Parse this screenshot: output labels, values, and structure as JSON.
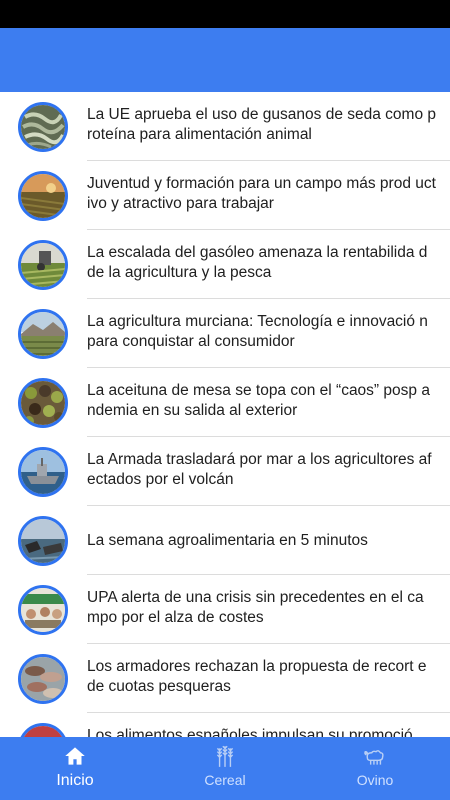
{
  "colors": {
    "primary": "#3d7df0",
    "thumb_border": "#2f73f0",
    "status_bar": "#000000"
  },
  "news": [
    {
      "title": "La UE aprueba el uso de gusanos de seda como proteína para alimentación animal",
      "thumb": "silkworms"
    },
    {
      "title": "Juventud y formación para un campo más prod uctivo y atractivo para trabajar",
      "thumb": "field-sunset"
    },
    {
      "title": "La escalada del gasóleo amenaza la rentabilida d de la agricultura y la pesca",
      "thumb": "tractor-field"
    },
    {
      "title": "La agricultura murciana: Tecnología e innovació n para conquistar al consumidor",
      "thumb": "mountain-field"
    },
    {
      "title": "La aceituna de mesa se topa con el “caos” posp andemia en su salida al exterior",
      "thumb": "olives"
    },
    {
      "title": "La Armada trasladará por mar a los agricultores afectados por el volcán",
      "thumb": "navy-ship"
    },
    {
      "title": "La semana agroalimentaria en 5 minutos",
      "thumb": "harbor"
    },
    {
      "title": "UPA alerta de una crisis sin precedentes en el ca mpo por el alza de costes",
      "thumb": "meeting"
    },
    {
      "title": "Los armadores rechazan la propuesta de recort e de cuotas pesqueras",
      "thumb": "fish"
    },
    {
      "title": "Los alimentos españoles impulsan su promoció",
      "thumb": "food"
    }
  ],
  "bottom_nav": [
    {
      "label": "Inicio",
      "icon": "home-icon",
      "active": true
    },
    {
      "label": "Cereal",
      "icon": "wheat-icon",
      "active": false
    },
    {
      "label": "Ovino",
      "icon": "sheep-icon",
      "active": false
    }
  ]
}
